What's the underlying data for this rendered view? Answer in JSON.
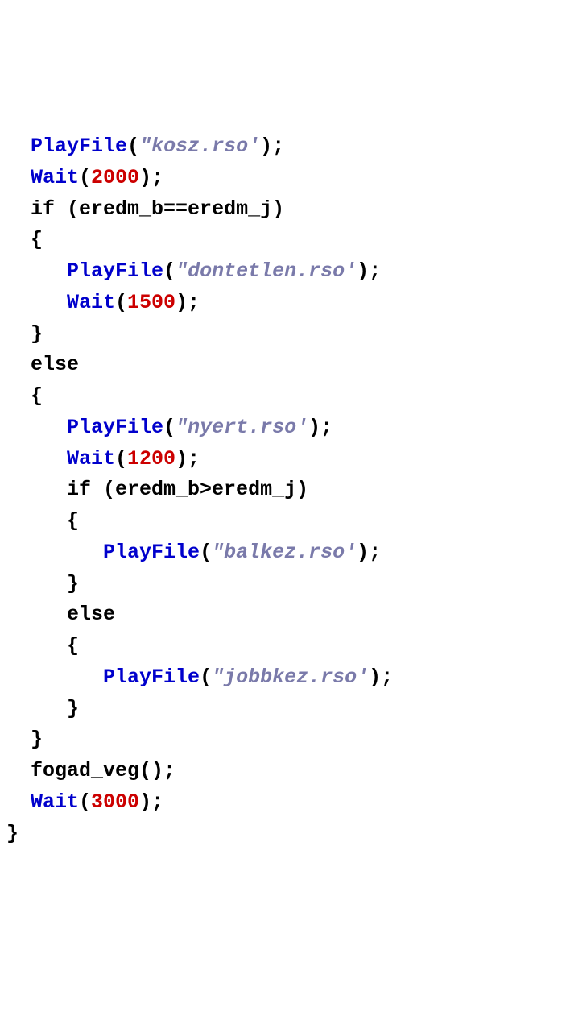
{
  "code": {
    "lines": [
      {
        "indent": "  ",
        "tokens": [
          {
            "cls": "fn",
            "t": "PlayFile"
          },
          {
            "cls": "",
            "t": "("
          },
          {
            "cls": "str",
            "t": "\"kosz.rso'"
          },
          {
            "cls": "",
            "t": ");"
          }
        ]
      },
      {
        "indent": "  ",
        "tokens": [
          {
            "cls": "fn",
            "t": "Wait"
          },
          {
            "cls": "",
            "t": "("
          },
          {
            "cls": "num",
            "t": "2000"
          },
          {
            "cls": "",
            "t": ");"
          }
        ]
      },
      {
        "indent": "  ",
        "tokens": [
          {
            "cls": "kw",
            "t": "if"
          },
          {
            "cls": "",
            "t": " (eredm_b==eredm_j)"
          }
        ]
      },
      {
        "indent": "  ",
        "tokens": [
          {
            "cls": "",
            "t": "{"
          }
        ]
      },
      {
        "indent": "     ",
        "tokens": [
          {
            "cls": "fn",
            "t": "PlayFile"
          },
          {
            "cls": "",
            "t": "("
          },
          {
            "cls": "str",
            "t": "\"dontetlen.rso'"
          },
          {
            "cls": "",
            "t": ");"
          }
        ]
      },
      {
        "indent": "     ",
        "tokens": [
          {
            "cls": "fn",
            "t": "Wait"
          },
          {
            "cls": "",
            "t": "("
          },
          {
            "cls": "num",
            "t": "1500"
          },
          {
            "cls": "",
            "t": ");"
          }
        ]
      },
      {
        "indent": "  ",
        "tokens": [
          {
            "cls": "",
            "t": "}"
          }
        ]
      },
      {
        "indent": "  ",
        "tokens": [
          {
            "cls": "kw",
            "t": "else"
          }
        ]
      },
      {
        "indent": "  ",
        "tokens": [
          {
            "cls": "",
            "t": "{"
          }
        ]
      },
      {
        "indent": "     ",
        "tokens": [
          {
            "cls": "fn",
            "t": "PlayFile"
          },
          {
            "cls": "",
            "t": "("
          },
          {
            "cls": "str",
            "t": "\"nyert.rso'"
          },
          {
            "cls": "",
            "t": ");"
          }
        ]
      },
      {
        "indent": "     ",
        "tokens": [
          {
            "cls": "fn",
            "t": "Wait"
          },
          {
            "cls": "",
            "t": "("
          },
          {
            "cls": "num",
            "t": "1200"
          },
          {
            "cls": "",
            "t": ");"
          }
        ]
      },
      {
        "indent": "     ",
        "tokens": [
          {
            "cls": "kw",
            "t": "if"
          },
          {
            "cls": "",
            "t": " (eredm_b>eredm_j)"
          }
        ]
      },
      {
        "indent": "     ",
        "tokens": [
          {
            "cls": "",
            "t": "{"
          }
        ]
      },
      {
        "indent": "        ",
        "tokens": [
          {
            "cls": "fn",
            "t": "PlayFile"
          },
          {
            "cls": "",
            "t": "("
          },
          {
            "cls": "str",
            "t": "\"balkez.rso'"
          },
          {
            "cls": "",
            "t": ");"
          }
        ]
      },
      {
        "indent": "     ",
        "tokens": [
          {
            "cls": "",
            "t": "}"
          }
        ]
      },
      {
        "indent": "     ",
        "tokens": [
          {
            "cls": "kw",
            "t": "else"
          }
        ]
      },
      {
        "indent": "     ",
        "tokens": [
          {
            "cls": "",
            "t": "{"
          }
        ]
      },
      {
        "indent": "        ",
        "tokens": [
          {
            "cls": "fn",
            "t": "PlayFile"
          },
          {
            "cls": "",
            "t": "("
          },
          {
            "cls": "str",
            "t": "\"jobbkez.rso'"
          },
          {
            "cls": "",
            "t": ");"
          }
        ]
      },
      {
        "indent": "     ",
        "tokens": [
          {
            "cls": "",
            "t": "}"
          }
        ]
      },
      {
        "indent": "  ",
        "tokens": [
          {
            "cls": "",
            "t": "}"
          }
        ]
      },
      {
        "indent": "  ",
        "tokens": [
          {
            "cls": "",
            "t": "fogad_veg();"
          }
        ]
      },
      {
        "indent": "  ",
        "tokens": [
          {
            "cls": "fn",
            "t": "Wait"
          },
          {
            "cls": "",
            "t": "("
          },
          {
            "cls": "num",
            "t": "3000"
          },
          {
            "cls": "",
            "t": ");"
          }
        ]
      },
      {
        "indent": "",
        "tokens": [
          {
            "cls": "",
            "t": "}"
          }
        ]
      }
    ]
  }
}
